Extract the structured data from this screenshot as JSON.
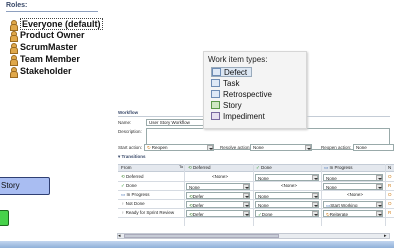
{
  "roles": {
    "title": "Roles:",
    "items": [
      {
        "label": "Everyone (default)"
      },
      {
        "label": "Product Owner"
      },
      {
        "label": "ScrumMaster"
      },
      {
        "label": "Team Member"
      },
      {
        "label": "Stakeholder"
      }
    ]
  },
  "work_item_types": {
    "title": "Work item types:",
    "items": [
      {
        "label": "Defect",
        "icon": "defect-icon"
      },
      {
        "label": "Task",
        "icon": "task-icon"
      },
      {
        "label": "Retrospective",
        "icon": "retrospective-icon"
      },
      {
        "label": "Story",
        "icon": "story-icon"
      },
      {
        "label": "Impediment",
        "icon": "impediment-icon"
      }
    ]
  },
  "workflow": {
    "section_title": "Workflow",
    "name_label": "Name:",
    "name_value": "User Story Workflow",
    "description_label": "Description:",
    "start_action_label": "Start action:",
    "start_action_value": "Reopen",
    "resolve_action_label": "Resolve action:",
    "resolve_action_value": "None",
    "reopen_action_label": "Reopen action:",
    "reopen_action_value": "None",
    "transitions_title": "Transitions",
    "from_label": "From",
    "to_label": "To",
    "columns": [
      "Deferred",
      "Done",
      "In Progress",
      "N"
    ],
    "rows": [
      {
        "from": "Deferred",
        "cells": [
          "<None>",
          "None",
          "None",
          "O"
        ]
      },
      {
        "from": "Done",
        "cells": [
          "None",
          "<None>",
          "None",
          "R"
        ]
      },
      {
        "from": "In Progress",
        "cells": [
          "Defer",
          "None",
          "<None>",
          "O"
        ]
      },
      {
        "from": "Not Done",
        "cells": [
          "Defer",
          "None",
          "Start Working",
          "O"
        ]
      },
      {
        "from": "Ready for Sprint Review",
        "cells": [
          "Defer",
          "Done",
          "Reiterate",
          "R"
        ]
      }
    ]
  },
  "story_card": {
    "label": "Story"
  },
  "colors": {
    "story_card": "#a9bdf2",
    "green_card": "#46d24a",
    "header_text": "#3a4a6a"
  }
}
